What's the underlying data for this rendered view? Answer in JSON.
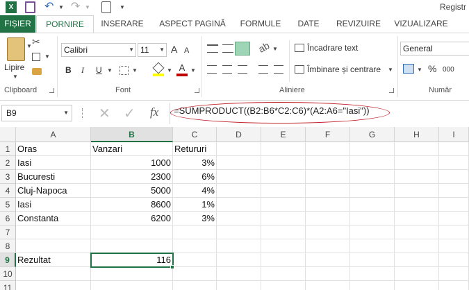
{
  "title": "Registr",
  "tabs": [
    {
      "label": "FIȘIER"
    },
    {
      "label": "PORNIRE"
    },
    {
      "label": "INSERARE"
    },
    {
      "label": "ASPECT PAGINĂ"
    },
    {
      "label": "FORMULE"
    },
    {
      "label": "DATE"
    },
    {
      "label": "REVIZUIRE"
    },
    {
      "label": "VIZUALIZARE"
    }
  ],
  "ribbon": {
    "paste_label": "Lipire",
    "font_name": "Calibri",
    "font_size": "11",
    "grow_font": "A",
    "shrink_font": "A",
    "bold": "B",
    "italic": "I",
    "underline": "U",
    "wrap_text": "Încadrare text",
    "merge_center": "Îmbinare și centrare",
    "number_format": "General",
    "percent": "%",
    "comma": "000",
    "groups": {
      "clipboard": "Clipboard",
      "font": "Font",
      "alignment": "Aliniere",
      "number": "Număr"
    },
    "colors": {
      "accent": "#217346",
      "highlight": "#ffff00",
      "font_color": "#c00000"
    }
  },
  "formula_bar": {
    "name_box": "B9",
    "fx": "fx",
    "formula": "=SUMPRODUCT((B2:B6*C2:C6)*(A2:A6=\"Iasi\"))",
    "annotation_color": "#c0262c"
  },
  "sheet": {
    "columns": [
      "A",
      "B",
      "C",
      "D",
      "E",
      "F",
      "G",
      "H",
      "I"
    ],
    "active_column": "B",
    "rows": [
      "1",
      "2",
      "3",
      "4",
      "5",
      "6",
      "7",
      "8",
      "9",
      "10",
      "11"
    ],
    "active_row": "9",
    "cells": {
      "A1": "Oras",
      "B1": "Vanzari",
      "C1": "Retururi",
      "A2": "Iasi",
      "B2": "1000",
      "C2": "3%",
      "A3": "Bucuresti",
      "B3": "2300",
      "C3": "6%",
      "A4": "Cluj-Napoca",
      "B4": "5000",
      "C4": "4%",
      "A5": "Iasi",
      "B5": "8600",
      "C5": "1%",
      "A6": "Constanta",
      "B6": "6200",
      "C6": "3%",
      "A9": "Rezultat",
      "B9": "116"
    }
  }
}
